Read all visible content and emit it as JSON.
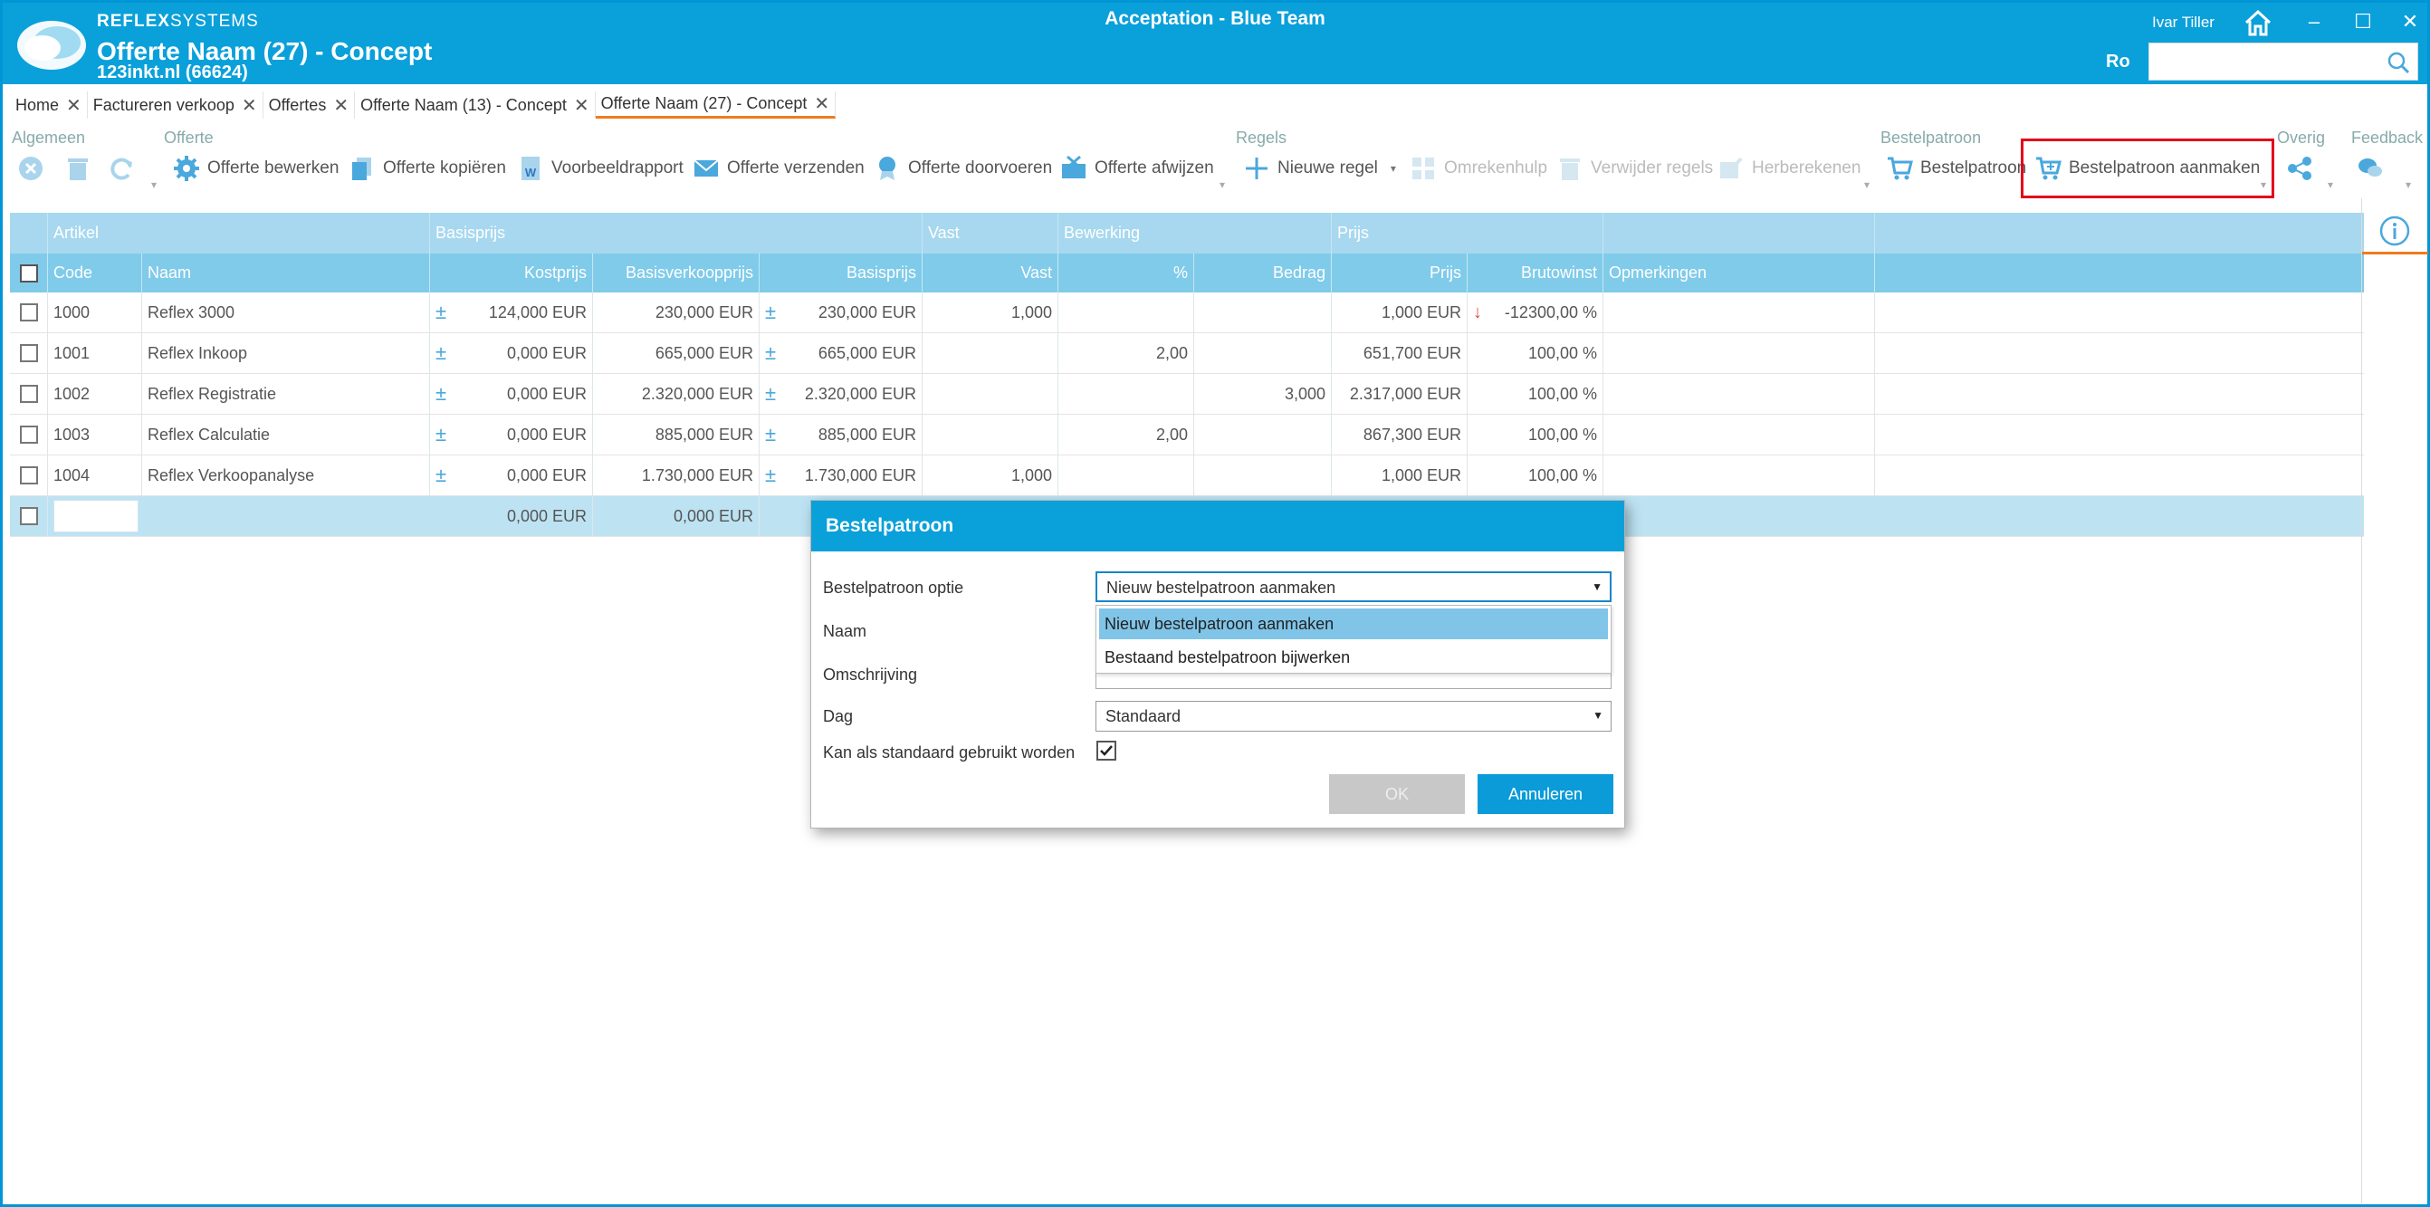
{
  "window": {
    "title": "Acceptation - Blue Team",
    "brand_bold": "REFLEX",
    "brand_thin": "SYSTEMS",
    "doc_title": "Offerte Naam (27) - Concept",
    "doc_subtitle": "123inkt.nl (66624)",
    "user": "Ivar Tiller",
    "lang": "Ro",
    "search": {
      "value": "",
      "placeholder": ""
    }
  },
  "tabs": [
    {
      "label": "Home"
    },
    {
      "label": "Factureren verkoop"
    },
    {
      "label": "Offertes"
    },
    {
      "label": "Offerte Naam (13) - Concept"
    },
    {
      "label": "Offerte Naam (27) - Concept"
    }
  ],
  "ribbon": {
    "groups": {
      "algemeen": "Algemeen",
      "offerte": "Offerte",
      "regels": "Regels",
      "bestelpatroon": "Bestelpatroon",
      "overig": "Overig",
      "feedback": "Feedback"
    },
    "buttons": {
      "offerte_bewerken": "Offerte bewerken",
      "offerte_kopieren": "Offerte kopiëren",
      "voorbeeldrapport": "Voorbeeldrapport",
      "offerte_verzenden": "Offerte verzenden",
      "offerte_doorvoeren": "Offerte doorvoeren",
      "offerte_afwijzen": "Offerte afwijzen",
      "nieuwe_regel": "Nieuwe regel",
      "omrekenhulp": "Omrekenhulp",
      "verwijder_regels": "Verwijder regels",
      "herberekenen": "Herberekenen",
      "bestelpatroon": "Bestelpatroon",
      "bestelpatroon_aanmaken": "Bestelpatroon aanmaken"
    }
  },
  "grid": {
    "groups": {
      "artikel": "Artikel",
      "basisprijs": "Basisprijs",
      "vast": "Vast",
      "bewerking": "Bewerking",
      "prijs": "Prijs"
    },
    "columns": {
      "code": "Code",
      "naam": "Naam",
      "kostprijs": "Kostprijs",
      "basisverkoopprijs": "Basisverkoopprijs",
      "basisprijs": "Basisprijs",
      "vast": "Vast",
      "pct": "%",
      "bedrag": "Bedrag",
      "prijs": "Prijs",
      "brutowinst": "Brutowinst",
      "opmerkingen": "Opmerkingen"
    },
    "rows": [
      {
        "code": "1000",
        "naam": "Reflex 3000",
        "kostprijs": "124,000 EUR",
        "basisverkoopprijs": "230,000 EUR",
        "basisprijs": "230,000 EUR",
        "vast": "1,000",
        "pct": "",
        "bedrag": "",
        "prijs": "1,000 EUR",
        "brutowinst": "-12300,00 %"
      },
      {
        "code": "1001",
        "naam": "Reflex Inkoop",
        "kostprijs": "0,000 EUR",
        "basisverkoopprijs": "665,000 EUR",
        "basisprijs": "665,000 EUR",
        "vast": "",
        "pct": "2,00",
        "bedrag": "",
        "prijs": "651,700 EUR",
        "brutowinst": "100,00 %"
      },
      {
        "code": "1002",
        "naam": "Reflex Registratie",
        "kostprijs": "0,000 EUR",
        "basisverkoopprijs": "2.320,000 EUR",
        "basisprijs": "2.320,000 EUR",
        "vast": "",
        "pct": "",
        "bedrag": "3,000",
        "prijs": "2.317,000 EUR",
        "brutowinst": "100,00 %"
      },
      {
        "code": "1003",
        "naam": "Reflex Calculatie",
        "kostprijs": "0,000 EUR",
        "basisverkoopprijs": "885,000 EUR",
        "basisprijs": "885,000 EUR",
        "vast": "",
        "pct": "2,00",
        "bedrag": "",
        "prijs": "867,300 EUR",
        "brutowinst": "100,00 %"
      },
      {
        "code": "1004",
        "naam": "Reflex Verkoopanalyse",
        "kostprijs": "0,000 EUR",
        "basisverkoopprijs": "1.730,000 EUR",
        "basisprijs": "1.730,000 EUR",
        "vast": "1,000",
        "pct": "",
        "bedrag": "",
        "prijs": "1,000 EUR",
        "brutowinst": "100,00 %"
      }
    ],
    "new_row": {
      "kostprijs": "0,000 EUR",
      "basisverkoopprijs": "0,000 EUR"
    }
  },
  "dialog": {
    "title": "Bestelpatroon",
    "labels": {
      "optie": "Bestelpatroon optie",
      "naam": "Naam",
      "omschrijving": "Omschrijving",
      "dag": "Dag",
      "standaard": "Kan als standaard gebruikt worden"
    },
    "optie_value": "Nieuw bestelpatroon aanmaken",
    "options": [
      "Nieuw bestelpatroon aanmaken",
      "Bestaand bestelpatroon bijwerken"
    ],
    "dag_value": "Standaard",
    "standaard_checked": true,
    "ok": "OK",
    "cancel": "Annuleren"
  },
  "colors": {
    "accent": "#0aa0da",
    "header_light": "#a7d8ef",
    "header_dark": "#80cbea",
    "active_tab": "#f07b1d",
    "highlight": "#e2001a"
  }
}
